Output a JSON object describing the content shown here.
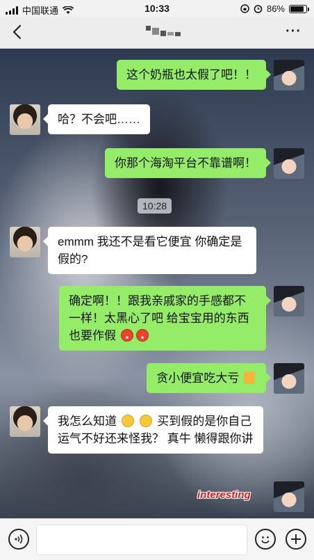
{
  "status_bar": {
    "carrier": "中国联通",
    "time": "10:33",
    "battery": "86%",
    "battery_level": 0.86
  },
  "nav": {
    "back_icon": "chevron-left-icon",
    "more_icon": "more-dots-icon",
    "more_label": "···"
  },
  "messages": [
    {
      "side": "right",
      "text": "这个奶瓶也太假了吧！！"
    },
    {
      "side": "left",
      "text": "哈？不会吧……"
    },
    {
      "side": "right",
      "text": "你那个海淘平台不靠谱啊！"
    },
    {
      "side": "left",
      "text": "emmm 我还不是看它便宜 你确定是假的?"
    },
    {
      "side": "right",
      "text": "确定啊！！跟我亲戚家的手感都不一样！太黑心了吧 给宝宝用的东西也要作假"
    },
    {
      "side": "right",
      "text": "贪小便宜吃大亏"
    },
    {
      "side": "left",
      "text_a": "我怎么知道",
      "text_b": "买到假的是你自己运气不好还来怪我？ 真牛 懒得跟你讲"
    }
  ],
  "timestamp": "10:28",
  "watermark": "interesting",
  "input": {
    "placeholder": "",
    "value": ""
  }
}
